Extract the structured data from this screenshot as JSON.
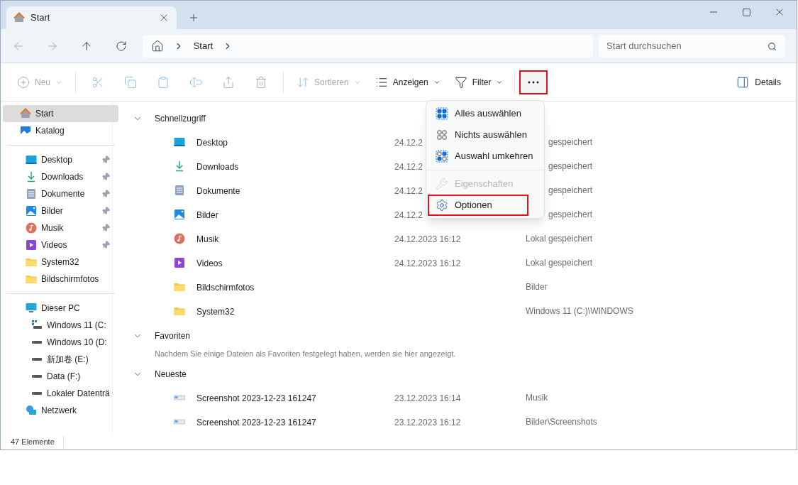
{
  "tab": {
    "title": "Start"
  },
  "breadcrumb": [
    "Start"
  ],
  "search": {
    "placeholder": "Start durchsuchen"
  },
  "toolbar": [
    {
      "kind": "new",
      "label": "Neu",
      "disabled": true
    },
    {
      "kind": "cut",
      "disabled": true
    },
    {
      "kind": "copy",
      "disabled": true
    },
    {
      "kind": "paste",
      "disabled": true
    },
    {
      "kind": "rename",
      "disabled": true
    },
    {
      "kind": "share",
      "disabled": true
    },
    {
      "kind": "delete",
      "disabled": true
    },
    {
      "kind": "sort",
      "label": "Sortieren",
      "disabled": true
    },
    {
      "kind": "view",
      "label": "Anzeigen",
      "disabled": false
    },
    {
      "kind": "filter",
      "label": "Filter",
      "disabled": false
    }
  ],
  "more_button": {
    "highlighted": true
  },
  "details_button": {
    "label": "Details"
  },
  "sidebar": [
    [
      {
        "kind": "home",
        "label": "Start",
        "selected": true,
        "pinned": false
      },
      {
        "kind": "gallery",
        "label": "Katalog",
        "selected": false,
        "pinned": false
      }
    ],
    [
      {
        "kind": "desktop",
        "label": "Desktop",
        "selected": false,
        "pinned": true
      },
      {
        "kind": "download",
        "label": "Downloads",
        "selected": false,
        "pinned": true
      },
      {
        "kind": "document",
        "label": "Dokumente",
        "selected": false,
        "pinned": true
      },
      {
        "kind": "picture",
        "label": "Bilder",
        "selected": false,
        "pinned": true
      },
      {
        "kind": "music",
        "label": "Musik",
        "selected": false,
        "pinned": true
      },
      {
        "kind": "video",
        "label": "Videos",
        "selected": false,
        "pinned": true
      },
      {
        "kind": "folder",
        "label": "System32",
        "selected": false,
        "pinned": false
      },
      {
        "kind": "folder",
        "label": "Bildschirmfotos",
        "selected": false,
        "pinned": false
      }
    ],
    [
      {
        "kind": "pc",
        "label": "Dieser PC",
        "selected": false,
        "pinned": false,
        "children": [
          {
            "kind": "windrive",
            "label": "Windows 11 (C:",
            "selected": false,
            "pinned": false
          },
          {
            "kind": "drive",
            "label": "Windows 10 (D:",
            "selected": false,
            "pinned": false
          },
          {
            "kind": "drive",
            "label": "新加卷 (E:)",
            "selected": false,
            "pinned": false
          },
          {
            "kind": "drive",
            "label": "Data (F:)",
            "selected": false,
            "pinned": false
          },
          {
            "kind": "drive",
            "label": "Lokaler Datenträ",
            "selected": false,
            "pinned": false
          }
        ]
      },
      {
        "kind": "network",
        "label": "Netzwerk",
        "selected": false,
        "pinned": false
      }
    ]
  ],
  "sections": [
    {
      "title": "Schnellzugriff",
      "expanded": true,
      "rows": [
        {
          "kind": "desktop",
          "name": "Desktop",
          "date": "24.12.2",
          "location": "gespeichert",
          "covered": true
        },
        {
          "kind": "download",
          "name": "Downloads",
          "date": "24.12.2",
          "location": "gespeichert",
          "covered": true
        },
        {
          "kind": "document",
          "name": "Dokumente",
          "date": "24.12.2",
          "location": "gespeichert",
          "covered": true
        },
        {
          "kind": "picture",
          "name": "Bilder",
          "date": "24.12.2",
          "location": "gespeichert",
          "covered": true
        },
        {
          "kind": "music",
          "name": "Musik",
          "date": "24.12.2023 16:12",
          "location": "Lokal gespeichert",
          "covered": false
        },
        {
          "kind": "video",
          "name": "Videos",
          "date": "24.12.2023 16:12",
          "location": "Lokal gespeichert",
          "covered": false
        },
        {
          "kind": "folder",
          "name": "Bildschirmfotos",
          "location": "Bilder",
          "covered": false
        },
        {
          "kind": "folder",
          "name": "System32",
          "location": "Windows 11 (C:)\\WINDOWS",
          "covered": false
        }
      ]
    },
    {
      "title": "Favoriten",
      "expanded": true,
      "message": "Nachdem Sie einige Dateien als Favoriten festgelegt haben, werden sie hier angezeigt."
    },
    {
      "title": "Neueste",
      "expanded": true,
      "rows": [
        {
          "kind": "screenshot",
          "name": "Screenshot 2023-12-23 161247",
          "date": "23.12.2023 16:14",
          "location": "Musik",
          "covered": false
        },
        {
          "kind": "screenshot",
          "name": "Screenshot 2023-12-23 161247",
          "date": "23.12.2023 16:12",
          "location": "Bilder\\Screenshots",
          "covered": false
        }
      ]
    }
  ],
  "menu": [
    [
      {
        "kind": "select-all",
        "label": "Alles auswählen",
        "disabled": false,
        "highlighted": false
      },
      {
        "kind": "select-none",
        "label": "Nichts auswählen",
        "disabled": false,
        "highlighted": false
      },
      {
        "kind": "invert",
        "label": "Auswahl umkehren",
        "disabled": false,
        "highlighted": false
      }
    ],
    [
      {
        "kind": "properties",
        "label": "Eigenschaften",
        "disabled": true,
        "highlighted": false
      },
      {
        "kind": "options",
        "label": "Optionen",
        "disabled": false,
        "highlighted": true
      }
    ]
  ],
  "status_bar": {
    "count": "47 Elemente"
  }
}
